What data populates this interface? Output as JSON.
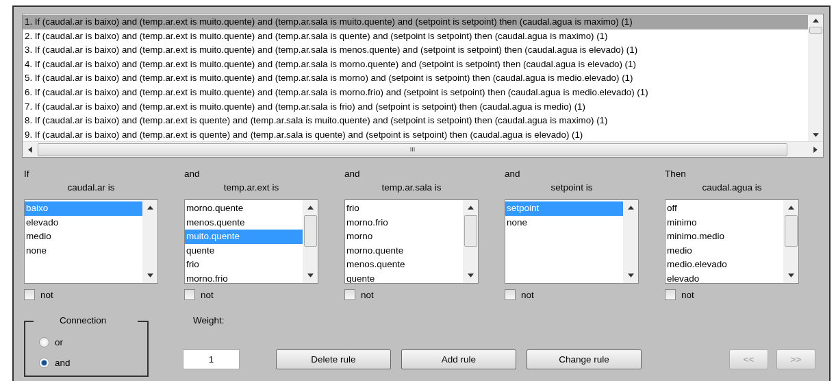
{
  "rules": [
    {
      "text": "1. If (caudal.ar is baixo) and (temp.ar.ext is muito.quente) and (temp.ar.sala is muito.quente) and (setpoint is setpoint) then (caudal.agua is maximo) (1)",
      "selected": true
    },
    {
      "text": "2. If (caudal.ar is baixo) and (temp.ar.ext is muito.quente) and (temp.ar.sala is quente) and (setpoint is setpoint) then (caudal.agua is maximo) (1)",
      "selected": false
    },
    {
      "text": "3. If (caudal.ar is baixo) and (temp.ar.ext is muito.quente) and (temp.ar.sala is menos.quente) and (setpoint is setpoint) then (caudal.agua is elevado) (1)",
      "selected": false
    },
    {
      "text": "4. If (caudal.ar is baixo) and (temp.ar.ext is muito.quente) and (temp.ar.sala is morno.quente) and (setpoint is setpoint) then (caudal.agua is elevado) (1)",
      "selected": false
    },
    {
      "text": "5. If (caudal.ar is baixo) and (temp.ar.ext is muito.quente) and (temp.ar.sala is morno) and (setpoint is setpoint) then (caudal.agua is medio.elevado) (1)",
      "selected": false
    },
    {
      "text": "6. If (caudal.ar is baixo) and (temp.ar.ext is muito.quente) and (temp.ar.sala is morno.frio) and (setpoint is setpoint) then (caudal.agua is medio.elevado) (1)",
      "selected": false
    },
    {
      "text": "7. If (caudal.ar is baixo) and (temp.ar.ext is muito.quente) and (temp.ar.sala is frio) and (setpoint is setpoint) then (caudal.agua is medio) (1)",
      "selected": false
    },
    {
      "text": "8. If (caudal.ar is baixo) and (temp.ar.ext is quente) and (temp.ar.sala is muito.quente) and (setpoint is setpoint) then (caudal.agua is maximo) (1)",
      "selected": false
    },
    {
      "text": "9. If (caudal.ar is baixo) and (temp.ar.ext is quente) and (temp.ar.sala is quente) and (setpoint is setpoint) then (caudal.agua is elevado) (1)",
      "selected": false
    }
  ],
  "scrollbar_label": "III",
  "columns": [
    {
      "connective": "If",
      "variable": "caudal.ar is",
      "not_checked": false,
      "not_label": "not",
      "items": [
        {
          "label": "baixo",
          "selected": true
        },
        {
          "label": "elevado",
          "selected": false
        },
        {
          "label": "medio",
          "selected": false
        },
        {
          "label": "none",
          "selected": false
        }
      ]
    },
    {
      "connective": "and",
      "variable": "temp.ar.ext is",
      "not_checked": false,
      "not_label": "not",
      "items": [
        {
          "label": "morno.quente",
          "selected": false
        },
        {
          "label": "menos.quente",
          "selected": false
        },
        {
          "label": "muito.quente",
          "selected": true
        },
        {
          "label": "quente",
          "selected": false
        },
        {
          "label": "frio",
          "selected": false
        },
        {
          "label": "morno.frio",
          "selected": false
        }
      ]
    },
    {
      "connective": "and",
      "variable": "temp.ar.sala is",
      "not_checked": false,
      "not_label": "not",
      "items": [
        {
          "label": "frio",
          "selected": false
        },
        {
          "label": "morno.frio",
          "selected": false
        },
        {
          "label": "morno",
          "selected": false
        },
        {
          "label": "morno.quente",
          "selected": false
        },
        {
          "label": "menos.quente",
          "selected": false
        },
        {
          "label": "quente",
          "selected": false
        }
      ]
    },
    {
      "connective": "and",
      "variable": "setpoint is",
      "not_checked": false,
      "not_label": "not",
      "items": [
        {
          "label": "setpoint",
          "selected": true
        },
        {
          "label": "none",
          "selected": false
        }
      ]
    },
    {
      "connective": "Then",
      "variable": "caudal.agua is",
      "not_checked": false,
      "not_label": "not",
      "items": [
        {
          "label": "off",
          "selected": false
        },
        {
          "label": "minimo",
          "selected": false
        },
        {
          "label": "minimo.medio",
          "selected": false
        },
        {
          "label": "medio",
          "selected": false
        },
        {
          "label": "medio.elevado",
          "selected": false
        },
        {
          "label": "elevado",
          "selected": false
        }
      ]
    }
  ],
  "connection": {
    "title": "Connection",
    "options": [
      {
        "label": "or",
        "selected": false
      },
      {
        "label": "and",
        "selected": true
      }
    ]
  },
  "weight": {
    "label": "Weight:",
    "value": "1"
  },
  "buttons": [
    {
      "label": "Delete rule",
      "disabled": false
    },
    {
      "label": "Add rule",
      "disabled": false
    },
    {
      "label": "Change rule",
      "disabled": false
    }
  ],
  "nav_buttons": [
    {
      "label": "<<",
      "disabled": true
    },
    {
      "label": ">>",
      "disabled": true
    }
  ]
}
